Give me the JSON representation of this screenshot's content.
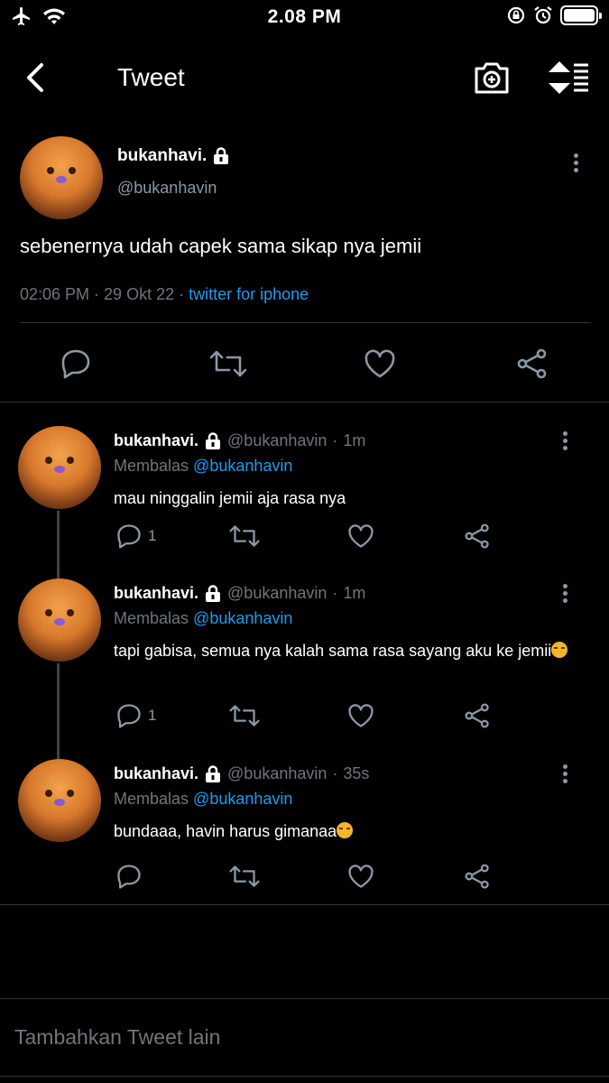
{
  "status_bar": {
    "time": "2.08 PM",
    "icons": [
      "airplane-icon",
      "wifi-icon",
      "rotation-lock-icon",
      "alarm-icon",
      "battery-icon"
    ]
  },
  "nav": {
    "title": "Tweet",
    "icons": [
      "back-arrow-icon",
      "camera-add-icon",
      "sort-icon"
    ]
  },
  "main_tweet": {
    "name": "bukanhavi.",
    "handle": "@bukanhavin",
    "text": "sebenernya udah capek sama sikap nya jemii",
    "timestamp": "02:06 PM · 29 Okt 22 · ",
    "source": "twitter for iphone",
    "protected": true
  },
  "replies": [
    {
      "name": "bukanhavi.",
      "handle": "@bukanhavin",
      "dot": "·",
      "time": "1m",
      "replying_label": "Membalas",
      "mention": "@bukanhavin",
      "text": "mau ninggalin jemii aja rasa nya",
      "reply_count": "1"
    },
    {
      "name": "bukanhavi.",
      "handle": "@bukanhavin",
      "dot": "·",
      "time": "1m",
      "replying_label": "Membalas",
      "mention": "@bukanhavin",
      "text": "tapi gabisa, semua nya kalah sama rasa sayang aku ke jemii",
      "reply_count": "1"
    },
    {
      "name": "bukanhavi.",
      "handle": "@bukanhavin",
      "dot": "·",
      "time": "35s",
      "replying_label": "Membalas",
      "mention": "@bukanhavin",
      "text": "bundaaa, havin harus gimanaa",
      "reply_count": ""
    }
  ],
  "compose": {
    "placeholder": "Tambahkan Tweet lain"
  },
  "colors": {
    "background": "#000000",
    "text": "#ffffff",
    "secondary": "#6e767d",
    "accent": "#1d9bf0",
    "divider": "#2f3336"
  }
}
